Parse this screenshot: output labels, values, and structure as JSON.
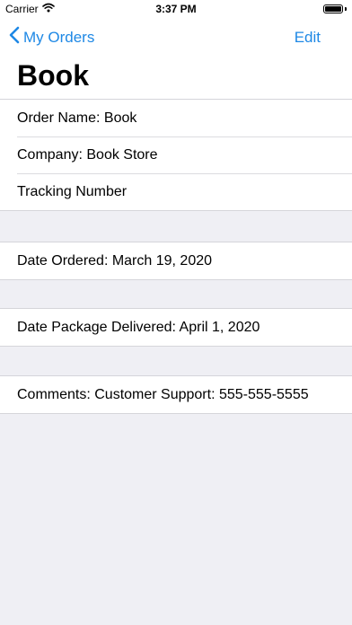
{
  "status_bar": {
    "carrier": "Carrier",
    "time": "3:37 PM",
    "battery_level": 1.0
  },
  "nav": {
    "back_label": "My Orders",
    "edit_label": "Edit",
    "title": "Book"
  },
  "sections": [
    {
      "rows": [
        "Order Name: Book",
        "Company: Book Store",
        "Tracking Number"
      ]
    },
    {
      "rows": [
        "Date Ordered: March 19, 2020"
      ]
    },
    {
      "rows": [
        "Date Package Delivered: April 1, 2020"
      ]
    },
    {
      "rows": [
        "Comments: Customer Support: 555-555-5555"
      ]
    }
  ],
  "colors": {
    "accent": "#1e88e5",
    "background": "#efeff4",
    "cell": "#ffffff"
  },
  "icons": {
    "wifi": "wifi-icon",
    "battery": "battery-icon",
    "back": "chevron-left-icon"
  }
}
